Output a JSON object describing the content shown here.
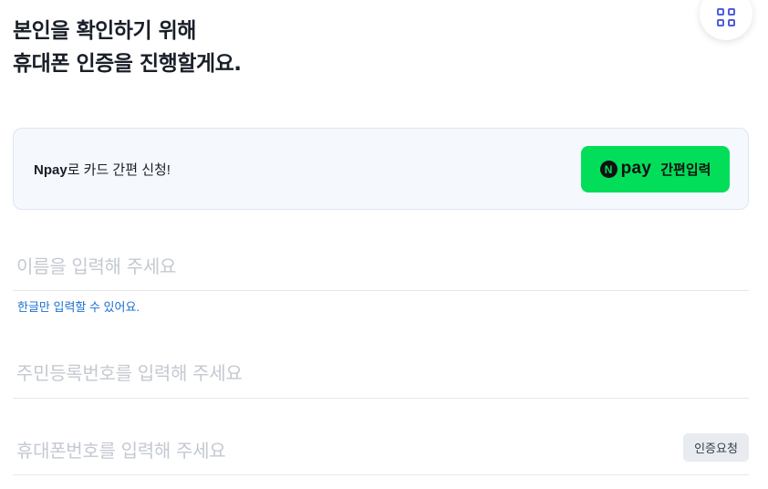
{
  "header": {
    "title_line1": "본인을 확인하기 위해",
    "title_line2": "휴대폰 인증을 진행할게요."
  },
  "menu_button": {
    "icon": "grid-icon",
    "accent": "#4e5fd7"
  },
  "npay_card": {
    "brand": "Npay",
    "text": "로 카드 간편 신청!",
    "button": {
      "logo_letter": "N",
      "logo_word": "pay",
      "label": "간편입력",
      "color": "#03de5a"
    }
  },
  "form": {
    "name": {
      "placeholder": "이름을 입력해 주세요",
      "helper": "한글만 입력할 수 있어요."
    },
    "rrn": {
      "placeholder": "주민등록번호를 입력해 주세요"
    },
    "phone": {
      "placeholder": "휴대폰번호를 입력해 주세요",
      "verify_button": "인증요청"
    }
  }
}
